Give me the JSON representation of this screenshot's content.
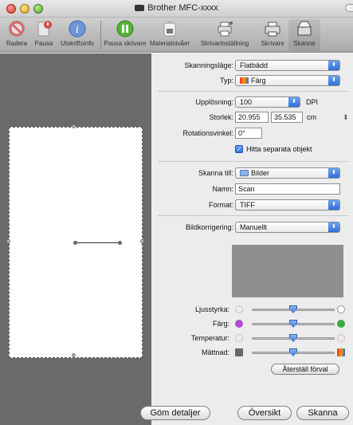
{
  "window": {
    "title": "Brother MFC-xxxx"
  },
  "toolbar": {
    "items": [
      {
        "label": "Radera",
        "icon": "delete-icon",
        "color": "#d04a4a"
      },
      {
        "label": "Pausa",
        "icon": "pause-job-icon",
        "color": "#d04a4a"
      },
      {
        "label": "Utskriftsinfo",
        "icon": "info-icon",
        "color": "#3a6fd0"
      },
      {
        "label": "Pausa skrivare",
        "icon": "pause-printer-icon",
        "color": "#3a9a2a"
      },
      {
        "label": "Materialnivåer",
        "icon": "supply-levels-icon",
        "color": "#777777"
      },
      {
        "label": "Skrivarinställning",
        "icon": "printer-setup-icon",
        "color": "#555555"
      },
      {
        "label": "Skrivare",
        "icon": "printer-icon",
        "color": "#444444"
      },
      {
        "label": "Skanne",
        "icon": "scanner-icon",
        "color": "#333333"
      }
    ]
  },
  "settings": {
    "scan_mode": {
      "label": "Skanningsläge:",
      "value": "Flatbädd"
    },
    "type": {
      "label": "Typ:",
      "value": "Färg"
    },
    "resolution": {
      "label": "Upplösning:",
      "value": "100",
      "unit": "DPI"
    },
    "size": {
      "label": "Storlek:",
      "width": "20.955",
      "height": "35.535",
      "unit": "cm"
    },
    "rotation": {
      "label": "Rotationsvinkel:",
      "value": "0°"
    },
    "detect_items": {
      "label": "Hitta separata objekt",
      "checked": true
    },
    "scan_to": {
      "label": "Skanna till:",
      "value": "Bilder"
    },
    "name": {
      "label": "Namn:",
      "value": "Scan"
    },
    "format": {
      "label": "Format:",
      "value": "TIFF"
    },
    "image_correction": {
      "label": "Bildkorrigering:",
      "value": "Manuellt"
    }
  },
  "adjustments": [
    {
      "label": "Ljusstyrka:",
      "level": 0.5
    },
    {
      "label": "Färg:",
      "level": 0.5
    },
    {
      "label": "Temperatur:",
      "level": 0.5
    },
    {
      "label": "Mättnad:",
      "level": 0.5
    }
  ],
  "buttons": {
    "reset": "Återställ förval",
    "hide_details": "Göm detaljer",
    "overview": "Översikt",
    "scan": "Skanna"
  },
  "colors": {
    "accent": "#2d6fd6",
    "preview_bg": "#6a6a6a"
  }
}
